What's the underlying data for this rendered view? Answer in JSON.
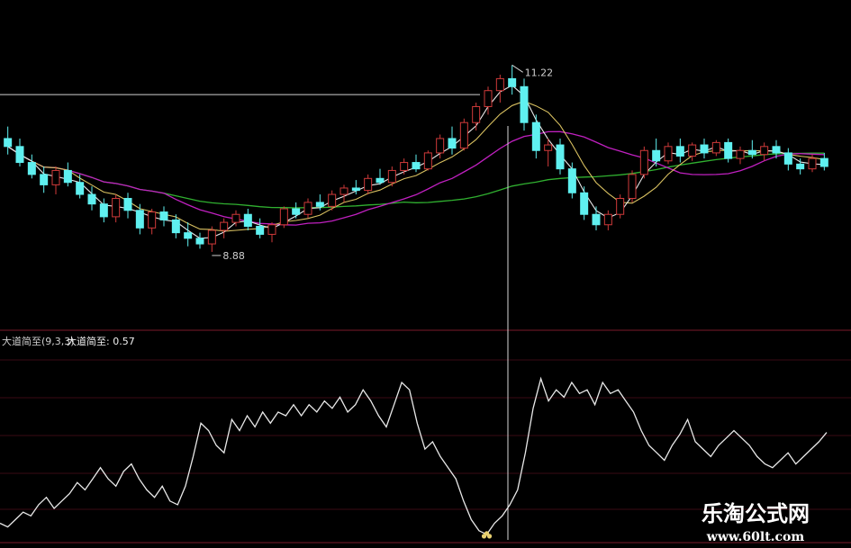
{
  "chart_data": [
    {
      "type": "candlestick",
      "title": "",
      "price_labels": {
        "high": "11.22",
        "low": "8.88"
      },
      "high_value": 11.22,
      "low_value": 8.88,
      "ylim": [
        8.0,
        11.9
      ],
      "reference_line": 10.85,
      "colors": {
        "up": "#d03a3a",
        "down": "#5ff0f0",
        "ma_white": "#e8e8e8",
        "ma_yellow": "#d8c060",
        "ma_magenta": "#c020c0",
        "ma_green": "#30b030"
      },
      "candles": [
        [
          10.3,
          10.45,
          10.1,
          10.2
        ],
        [
          10.2,
          10.3,
          9.95,
          10.0
        ],
        [
          10.0,
          10.1,
          9.8,
          9.85
        ],
        [
          9.85,
          9.95,
          9.62,
          9.72
        ],
        [
          9.72,
          9.95,
          9.6,
          9.9
        ],
        [
          9.9,
          10.0,
          9.7,
          9.75
        ],
        [
          9.75,
          9.85,
          9.55,
          9.6
        ],
        [
          9.6,
          9.7,
          9.4,
          9.48
        ],
        [
          9.48,
          9.55,
          9.25,
          9.32
        ],
        [
          9.32,
          9.6,
          9.25,
          9.55
        ],
        [
          9.55,
          9.62,
          9.3,
          9.4
        ],
        [
          9.4,
          9.48,
          9.1,
          9.18
        ],
        [
          9.18,
          9.42,
          9.1,
          9.38
        ],
        [
          9.38,
          9.45,
          9.2,
          9.28
        ],
        [
          9.28,
          9.35,
          9.05,
          9.12
        ],
        [
          9.12,
          9.25,
          8.95,
          9.05
        ],
        [
          9.05,
          9.12,
          8.92,
          8.98
        ],
        [
          8.98,
          9.2,
          8.88,
          9.15
        ],
        [
          9.15,
          9.3,
          9.05,
          9.25
        ],
        [
          9.25,
          9.4,
          9.2,
          9.35
        ],
        [
          9.35,
          9.42,
          9.15,
          9.2
        ],
        [
          9.2,
          9.3,
          9.05,
          9.1
        ],
        [
          9.1,
          9.25,
          9.0,
          9.22
        ],
        [
          9.22,
          9.45,
          9.18,
          9.42
        ],
        [
          9.42,
          9.5,
          9.3,
          9.35
        ],
        [
          9.35,
          9.55,
          9.3,
          9.5
        ],
        [
          9.5,
          9.6,
          9.4,
          9.45
        ],
        [
          9.45,
          9.65,
          9.4,
          9.6
        ],
        [
          9.6,
          9.72,
          9.5,
          9.68
        ],
        [
          9.68,
          9.78,
          9.6,
          9.65
        ],
        [
          9.65,
          9.85,
          9.6,
          9.8
        ],
        [
          9.8,
          9.92,
          9.72,
          9.75
        ],
        [
          9.75,
          9.95,
          9.7,
          9.9
        ],
        [
          9.9,
          10.05,
          9.85,
          10.0
        ],
        [
          10.0,
          10.1,
          9.88,
          9.92
        ],
        [
          9.92,
          10.15,
          9.9,
          10.12
        ],
        [
          10.12,
          10.35,
          10.05,
          10.3
        ],
        [
          10.3,
          10.45,
          10.1,
          10.18
        ],
        [
          10.18,
          10.55,
          10.15,
          10.5
        ],
        [
          10.5,
          10.75,
          10.4,
          10.7
        ],
        [
          10.7,
          10.95,
          10.6,
          10.9
        ],
        [
          10.9,
          11.1,
          10.75,
          11.05
        ],
        [
          11.05,
          11.22,
          10.85,
          10.95
        ],
        [
          10.95,
          11.05,
          10.4,
          10.5
        ],
        [
          10.5,
          10.6,
          10.05,
          10.15
        ],
        [
          10.15,
          10.3,
          9.95,
          10.22
        ],
        [
          10.22,
          10.3,
          9.85,
          9.92
        ],
        [
          9.92,
          10.0,
          9.55,
          9.62
        ],
        [
          9.62,
          9.7,
          9.28,
          9.35
        ],
        [
          9.35,
          9.45,
          9.15,
          9.22
        ],
        [
          9.22,
          9.4,
          9.15,
          9.35
        ],
        [
          9.35,
          9.6,
          9.3,
          9.55
        ],
        [
          9.55,
          9.9,
          9.5,
          9.85
        ],
        [
          9.85,
          10.2,
          9.8,
          10.15
        ],
        [
          10.15,
          10.3,
          9.95,
          10.02
        ],
        [
          10.02,
          10.25,
          9.98,
          10.2
        ],
        [
          10.2,
          10.3,
          10.0,
          10.08
        ],
        [
          10.08,
          10.25,
          10.02,
          10.22
        ],
        [
          10.22,
          10.3,
          10.05,
          10.12
        ],
        [
          10.12,
          10.28,
          10.08,
          10.25
        ],
        [
          10.25,
          10.3,
          10.0,
          10.05
        ],
        [
          10.05,
          10.2,
          9.98,
          10.15
        ],
        [
          10.15,
          10.28,
          10.05,
          10.1
        ],
        [
          10.1,
          10.25,
          10.02,
          10.2
        ],
        [
          10.2,
          10.28,
          10.05,
          10.12
        ],
        [
          10.12,
          10.18,
          9.9,
          9.98
        ],
        [
          9.98,
          10.05,
          9.85,
          9.92
        ],
        [
          9.92,
          10.1,
          9.88,
          10.05
        ],
        [
          10.05,
          10.12,
          9.9,
          9.95
        ]
      ]
    },
    {
      "type": "line",
      "indicator_label": "大道简至(9,3,3)",
      "value_label": "大道简至: 0.57",
      "series_color": "#e8e8e8",
      "ylim": [
        0,
        1
      ],
      "values": [
        0.08,
        0.06,
        0.1,
        0.14,
        0.12,
        0.18,
        0.22,
        0.16,
        0.2,
        0.24,
        0.3,
        0.26,
        0.32,
        0.38,
        0.32,
        0.28,
        0.36,
        0.4,
        0.32,
        0.26,
        0.22,
        0.28,
        0.2,
        0.18,
        0.28,
        0.44,
        0.62,
        0.58,
        0.5,
        0.46,
        0.64,
        0.58,
        0.66,
        0.6,
        0.68,
        0.62,
        0.68,
        0.66,
        0.72,
        0.66,
        0.72,
        0.68,
        0.74,
        0.7,
        0.76,
        0.68,
        0.72,
        0.8,
        0.74,
        0.66,
        0.6,
        0.72,
        0.84,
        0.8,
        0.62,
        0.48,
        0.52,
        0.44,
        0.38,
        0.32,
        0.2,
        0.1,
        0.04,
        0.02,
        0.08,
        0.12,
        0.18,
        0.26,
        0.46,
        0.7,
        0.86,
        0.74,
        0.8,
        0.76,
        0.84,
        0.78,
        0.8,
        0.72,
        0.84,
        0.78,
        0.8,
        0.74,
        0.68,
        0.58,
        0.5,
        0.46,
        0.42,
        0.5,
        0.56,
        0.64,
        0.52,
        0.48,
        0.44,
        0.5,
        0.54,
        0.58,
        0.54,
        0.5,
        0.44,
        0.4,
        0.38,
        0.42,
        0.46,
        0.4,
        0.44,
        0.48,
        0.52,
        0.57
      ],
      "bottom_marker": true
    }
  ],
  "watermark": {
    "brand": "乐淘公式网",
    "url": "www.60lt.com"
  }
}
